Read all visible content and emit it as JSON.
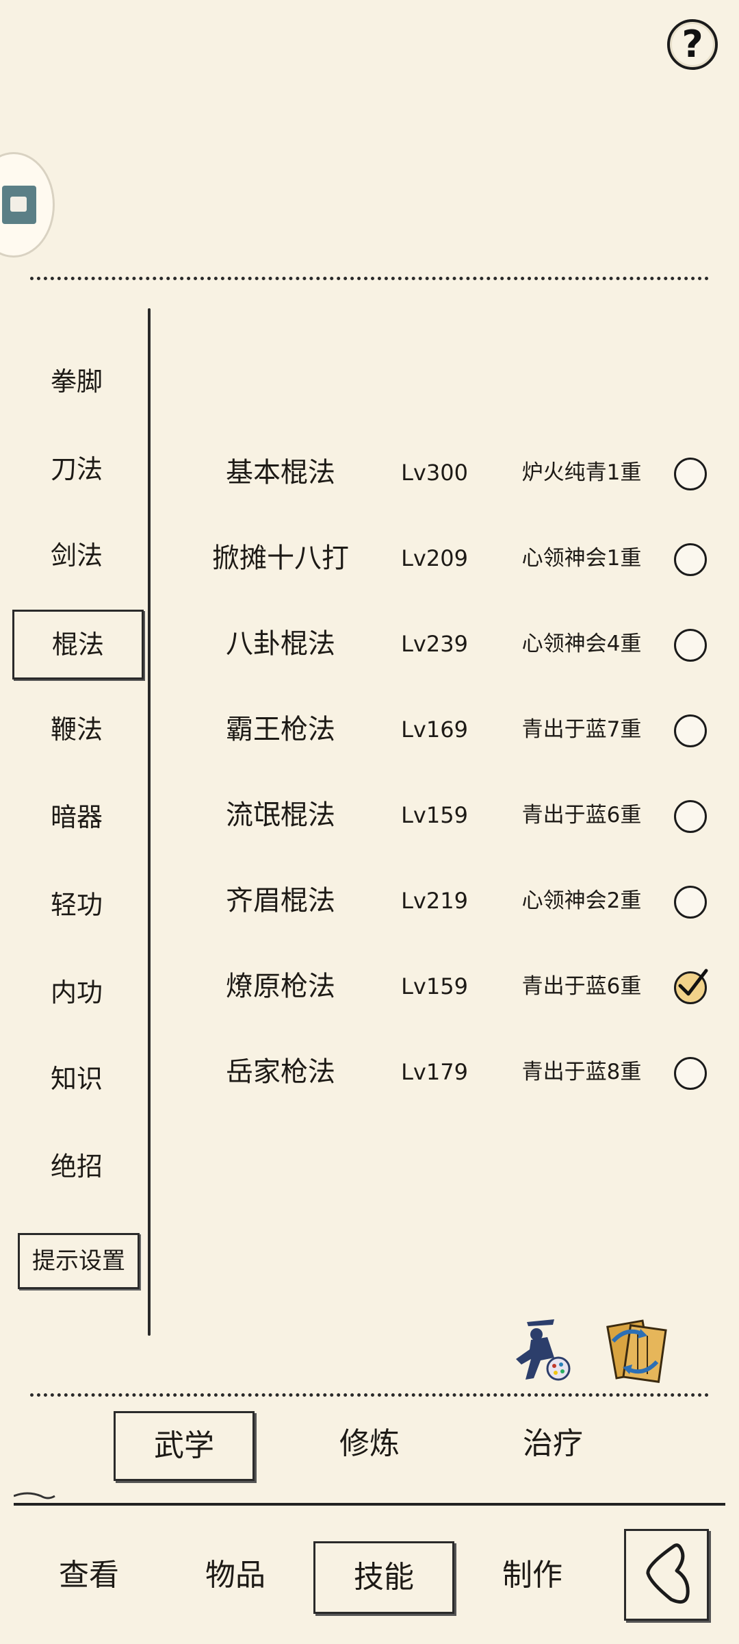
{
  "help": {
    "label": "?"
  },
  "categories": [
    {
      "label": "拳脚",
      "active": false
    },
    {
      "label": "刀法",
      "active": false
    },
    {
      "label": "剑法",
      "active": false
    },
    {
      "label": "棍法",
      "active": true
    },
    {
      "label": "鞭法",
      "active": false
    },
    {
      "label": "暗器",
      "active": false
    },
    {
      "label": "轻功",
      "active": false
    },
    {
      "label": "内功",
      "active": false
    },
    {
      "label": "知识",
      "active": false
    },
    {
      "label": "绝招",
      "active": false
    }
  ],
  "hint_settings_label": "提示设置",
  "skills": [
    {
      "name": "基本棍法",
      "level": "Lv300",
      "rank": "炉火纯青1重",
      "checked": false
    },
    {
      "name": "掀摊十八打",
      "level": "Lv209",
      "rank": "心领神会1重",
      "checked": false
    },
    {
      "name": "八卦棍法",
      "level": "Lv239",
      "rank": "心领神会4重",
      "checked": false
    },
    {
      "name": "霸王枪法",
      "level": "Lv169",
      "rank": "青出于蓝7重",
      "checked": false
    },
    {
      "name": "流氓棍法",
      "level": "Lv159",
      "rank": "青出于蓝6重",
      "checked": false
    },
    {
      "name": "齐眉棍法",
      "level": "Lv219",
      "rank": "心领神会2重",
      "checked": false
    },
    {
      "name": "燎原枪法",
      "level": "Lv159",
      "rank": "青出于蓝6重",
      "checked": true
    },
    {
      "name": "岳家枪法",
      "level": "Lv179",
      "rank": "青出于蓝8重",
      "checked": false
    }
  ],
  "sub_tabs": [
    {
      "label": "武学",
      "active": true
    },
    {
      "label": "修炼",
      "active": false
    },
    {
      "label": "治疗",
      "active": false
    }
  ],
  "nav": [
    {
      "label": "查看",
      "active": false
    },
    {
      "label": "物品",
      "active": false
    },
    {
      "label": "技能",
      "active": true
    },
    {
      "label": "制作",
      "active": false
    }
  ],
  "icons": {
    "help": "question-icon",
    "avatar": "avatar-icon",
    "martial": "martial-artist-icon",
    "swap": "scroll-swap-icon",
    "back": "back-icon"
  },
  "colors": {
    "background": "#f8f2e3",
    "ink": "#1d1a16",
    "check_fill": "#f1d28a"
  }
}
